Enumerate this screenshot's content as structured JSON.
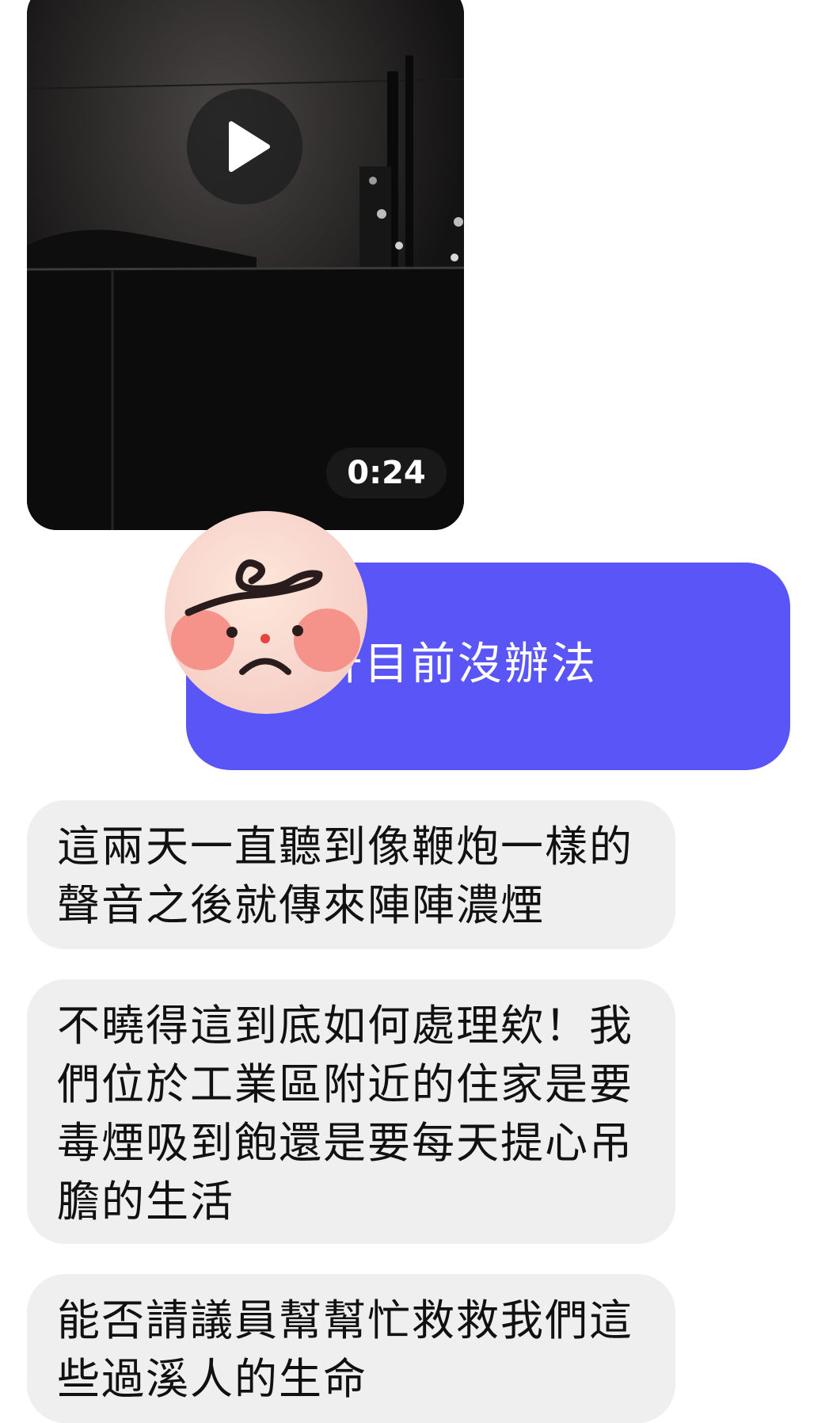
{
  "conversation": {
    "video_message": {
      "duration": "0:24",
      "play_icon": "play-icon"
    },
    "outgoing_message": {
      "text": "！于軒目前沒辦法"
    },
    "sticker": {
      "icon": "sad-face-sticker-icon"
    },
    "incoming_messages": [
      {
        "text": "這兩天一直聽到像鞭炮一樣的聲音之後就傳來陣陣濃煙"
      },
      {
        "text": "不曉得這到底如何處理欸！我們位於工業區附近的住家是要毒煙吸到飽還是要每天提心吊膽的生活"
      },
      {
        "text": "能否請議員幫幫忙救救我們這些過溪人的生命"
      }
    ]
  },
  "colors": {
    "outgoing_bubble": "#5a55f6",
    "incoming_bubble": "#efefef",
    "incoming_text": "#111111",
    "outgoing_text": "#ffffff"
  }
}
